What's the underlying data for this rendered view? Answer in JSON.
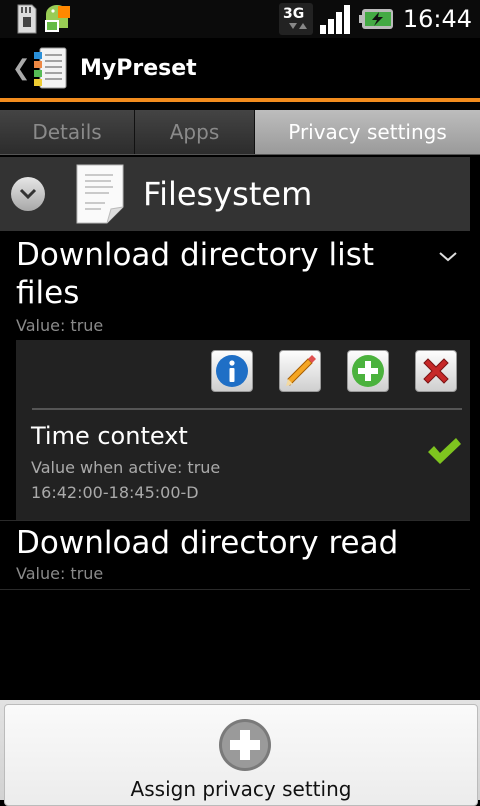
{
  "status_bar": {
    "time": "16:44",
    "network": "3G"
  },
  "app_bar": {
    "title": "MyPreset"
  },
  "tabs": [
    {
      "label": "Details",
      "active": false
    },
    {
      "label": "Apps",
      "active": false
    },
    {
      "label": "Privacy settings",
      "active": true
    }
  ],
  "category": {
    "title": "Filesystem"
  },
  "settings": [
    {
      "title": "Download directory list files",
      "value": "Value: true",
      "context": {
        "title": "Time context",
        "value_line": "Value when active: true",
        "time_line": "16:42:00-18:45:00-D"
      }
    },
    {
      "title": "Download directory read",
      "value": "Value: true"
    }
  ],
  "bottom": {
    "label": "Assign privacy setting"
  },
  "colors": {
    "accent": "#f28c1e",
    "panel": "#333333",
    "check": "#7ec41f"
  }
}
